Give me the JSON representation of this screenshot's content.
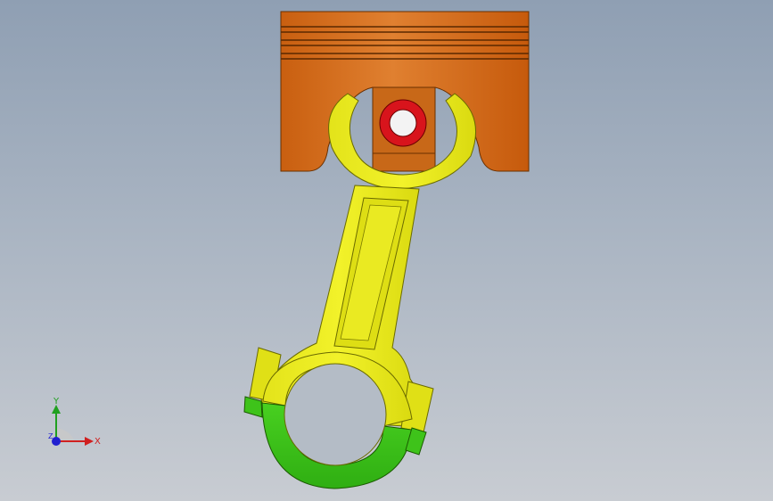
{
  "viewport": {
    "background_top": "#8f9fb3",
    "background_bottom": "#c8ccd2"
  },
  "model": {
    "parts": [
      {
        "name": "piston",
        "color": "#d46a12"
      },
      {
        "name": "piston-pin",
        "color": "#d8141c"
      },
      {
        "name": "connecting-rod",
        "color": "#e8e80a"
      },
      {
        "name": "rod-cap",
        "color": "#3ec31a"
      }
    ]
  },
  "triad": {
    "x_label": "X",
    "y_label": "Y",
    "z_label": "Z",
    "x_color": "#d02020",
    "y_color": "#20a020",
    "z_color": "#2020d0"
  }
}
